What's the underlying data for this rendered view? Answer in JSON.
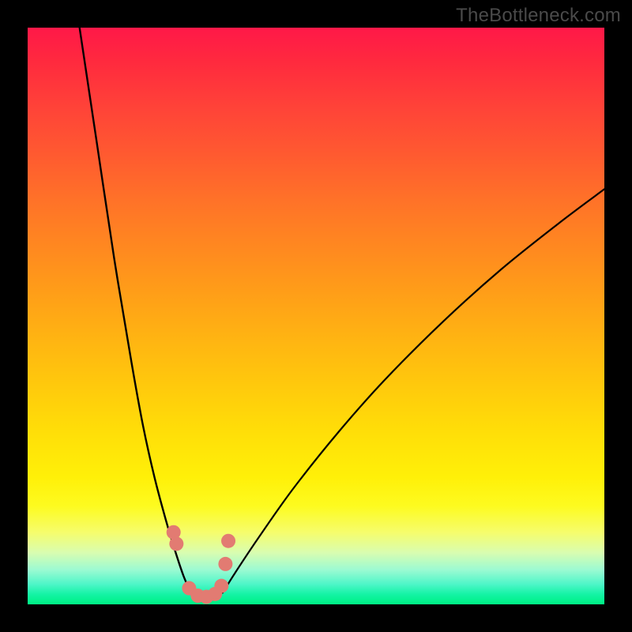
{
  "watermark": "TheBottleneck.com",
  "chart_data": {
    "type": "line",
    "title": "",
    "xlabel": "",
    "ylabel": "",
    "xlim": [
      0,
      100
    ],
    "ylim": [
      0,
      100
    ],
    "grid": false,
    "legend": false,
    "background": "red-yellow-green vertical gradient",
    "description": "Bottleneck percentage curve with a V-shaped minimum near x≈30; two black curve branches descend from top edges to a rounded minimum; salmon dot markers cluster at the valley.",
    "series": [
      {
        "name": "left-branch",
        "stroke": "#000000",
        "x": [
          9.0,
          12.0,
          15.0,
          18.0,
          20.0,
          22.0,
          24.0,
          25.5,
          27.0,
          28.3
        ],
        "y": [
          100.0,
          80.0,
          60.0,
          42.0,
          31.0,
          22.0,
          14.5,
          9.5,
          5.0,
          2.0
        ]
      },
      {
        "name": "right-branch",
        "stroke": "#000000",
        "x": [
          33.8,
          36.0,
          40.0,
          46.0,
          54.0,
          62.0,
          72.0,
          82.0,
          92.0,
          100.0
        ],
        "y": [
          2.0,
          5.5,
          11.5,
          20.0,
          30.0,
          39.0,
          49.0,
          58.0,
          66.0,
          72.0
        ]
      },
      {
        "name": "valley-markers",
        "stroke": "#e27b72",
        "marker": "circle",
        "x": [
          25.3,
          25.8,
          28.0,
          29.5,
          31.0,
          32.5,
          33.6,
          34.3,
          34.8
        ],
        "y": [
          12.5,
          10.5,
          2.8,
          1.5,
          1.3,
          1.8,
          3.2,
          7.0,
          11.0
        ]
      }
    ],
    "gradient_stops": [
      {
        "pos": 0.0,
        "color": "#ff1848"
      },
      {
        "pos": 0.5,
        "color": "#ffbc10"
      },
      {
        "pos": 0.8,
        "color": "#fdfb20"
      },
      {
        "pos": 1.0,
        "color": "#00f184"
      }
    ]
  }
}
